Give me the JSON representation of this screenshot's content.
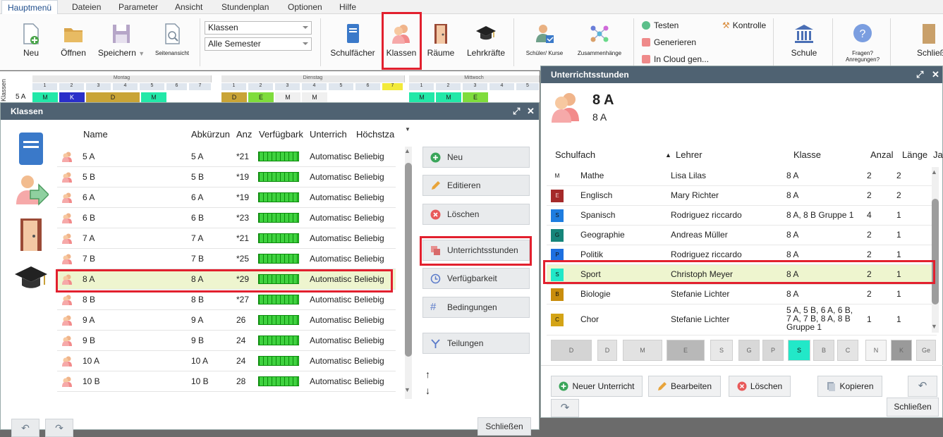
{
  "menu": {
    "items": [
      "Hauptmenü",
      "Dateien",
      "Parameter",
      "Ansicht",
      "Stundenplan",
      "Optionen",
      "Hilfe"
    ]
  },
  "ribbon": {
    "neu": "Neu",
    "oeffnen": "Öffnen",
    "speichern": "Speichern",
    "seitenansicht": "Seitenansicht",
    "select_klassen": "Klassen",
    "select_semester": "Alle Semester",
    "schulfaecher": "Schulfächer",
    "klassen": "Klassen",
    "raeume": "Räume",
    "lehrkraefte": "Lehrkräfte",
    "schueler_kurse": "Schüler/ Kurse",
    "zusammenhaenge": "Zusammenhänge",
    "testen": "Testen",
    "generieren": "Generieren",
    "cloud": "In Cloud gen...",
    "kontrolle": "Kontrolle",
    "schule": "Schule",
    "fragen": "Fragen? Anregungen?",
    "schliessen": "Schließ"
  },
  "grid": {
    "days": [
      "Montag",
      "Dienstag",
      "Mittwoch"
    ],
    "hours": [
      "1",
      "2",
      "3",
      "4",
      "5",
      "6",
      "7"
    ],
    "side_label": "Klassen",
    "row_label": "5 A",
    "lessons_mon": [
      "M",
      "K",
      "D",
      "M"
    ],
    "lessons_tue": [
      "D",
      "E",
      "M",
      "M"
    ],
    "lessons_wed": [
      "M",
      "M",
      "E"
    ]
  },
  "klassen_dialog": {
    "title": "Klassen",
    "columns": [
      "Name",
      "Abkürzun",
      "Anz",
      "Verfügbark",
      "Unterrich",
      "Höchstza"
    ],
    "rows": [
      {
        "name": "5 A",
        "abbr": "5 A",
        "count": "*21",
        "unterricht": "Automatisc",
        "hoechst": "Beliebig"
      },
      {
        "name": "5 B",
        "abbr": "5 B",
        "count": "*19",
        "unterricht": "Automatisc",
        "hoechst": "Beliebig"
      },
      {
        "name": "6 A",
        "abbr": "6 A",
        "count": "*19",
        "unterricht": "Automatisc",
        "hoechst": "Beliebig"
      },
      {
        "name": "6 B",
        "abbr": "6 B",
        "count": "*23",
        "unterricht": "Automatisc",
        "hoechst": "Beliebig"
      },
      {
        "name": "7 A",
        "abbr": "7 A",
        "count": "*21",
        "unterricht": "Automatisc",
        "hoechst": "Beliebig"
      },
      {
        "name": "7 B",
        "abbr": "7 B",
        "count": "*25",
        "unterricht": "Automatisc",
        "hoechst": "Beliebig"
      },
      {
        "name": "8 A",
        "abbr": "8 A",
        "count": "*29",
        "unterricht": "Automatisc",
        "hoechst": "Beliebig"
      },
      {
        "name": "8 B",
        "abbr": "8 B",
        "count": "*27",
        "unterricht": "Automatisc",
        "hoechst": "Beliebig"
      },
      {
        "name": "9 A",
        "abbr": "9 A",
        "count": "26",
        "unterricht": "Automatisc",
        "hoechst": "Beliebig"
      },
      {
        "name": "9 B",
        "abbr": "9 B",
        "count": "24",
        "unterricht": "Automatisc",
        "hoechst": "Beliebig"
      },
      {
        "name": "10 A",
        "abbr": "10 A",
        "count": "24",
        "unterricht": "Automatisc",
        "hoechst": "Beliebig"
      },
      {
        "name": "10 B",
        "abbr": "10 B",
        "count": "28",
        "unterricht": "Automatisc",
        "hoechst": "Beliebig"
      }
    ],
    "selected_index": 6,
    "buttons": {
      "neu": "Neu",
      "editieren": "Editieren",
      "loeschen": "Löschen",
      "unterrichtsstunden": "Unterrichtsstunden",
      "verfuegbarkeit": "Verfügbarkeit",
      "bedingungen": "Bedingungen",
      "teilungen": "Teilungen",
      "up": "↑",
      "down": "↓",
      "schliessen": "Schließen"
    }
  },
  "unterricht_dialog": {
    "title": "Unterrichtsstunden",
    "class_name": "8 A",
    "class_sub": "8 A",
    "columns": [
      "Schulfach",
      "Lehrer",
      "Klasse",
      "Anzal",
      "Länge",
      "Ja"
    ],
    "rows": [
      {
        "badge": "M",
        "color": "#ffffff",
        "subject": "Mathe",
        "teacher": "Lisa Lilas",
        "klasse": "8 A",
        "anzahl": "2",
        "laenge": "2"
      },
      {
        "badge": "E",
        "color": "#a52a2a",
        "subject": "Englisch",
        "teacher": "Mary Richter",
        "klasse": "8 A",
        "anzahl": "2",
        "laenge": "2"
      },
      {
        "badge": "S",
        "color": "#1e7de0",
        "subject": "Spanisch",
        "teacher": "Rodriguez riccardo",
        "klasse": "8 A, 8 B Gruppe 1",
        "anzahl": "4",
        "laenge": "1"
      },
      {
        "badge": "G",
        "color": "#16857a",
        "subject": "Geographie",
        "teacher": "Andreas Müller",
        "klasse": "8 A",
        "anzahl": "2",
        "laenge": "1"
      },
      {
        "badge": "P",
        "color": "#1d6fe0",
        "subject": "Politik",
        "teacher": "Rodriguez riccardo",
        "klasse": "8 A",
        "anzahl": "2",
        "laenge": "1"
      },
      {
        "badge": "S",
        "color": "#22e8c8",
        "subject": "Sport",
        "teacher": "Christoph Meyer",
        "klasse": "8 A",
        "anzahl": "2",
        "laenge": "1"
      },
      {
        "badge": "B",
        "color": "#c98d0c",
        "subject": "Biologie",
        "teacher": "Stefanie Lichter",
        "klasse": "8 A",
        "anzahl": "2",
        "laenge": "1"
      },
      {
        "badge": "C",
        "color": "#d4a416",
        "subject": "Chor",
        "teacher": "Stefanie Lichter",
        "klasse": "5 A, 5 B, 6 A, 6 B, 7 A, 7 B, 8 A, 8 B Gruppe 1",
        "anzahl": "1",
        "laenge": "1"
      }
    ],
    "selected_index": 5,
    "cards": [
      "D",
      "D",
      "M",
      "E",
      "S",
      "G",
      "P",
      "S",
      "B",
      "C",
      "N",
      "K",
      "Ge"
    ],
    "buttons": {
      "neuer_unterricht": "Neuer Unterricht",
      "bearbeiten": "Bearbeiten",
      "loeschen": "Löschen",
      "kopieren": "Kopieren",
      "schliessen": "Schließen"
    }
  },
  "colors": {
    "accent": "#4f6272",
    "highlight": "#e2202e",
    "selected_row": "#eef5cf"
  }
}
